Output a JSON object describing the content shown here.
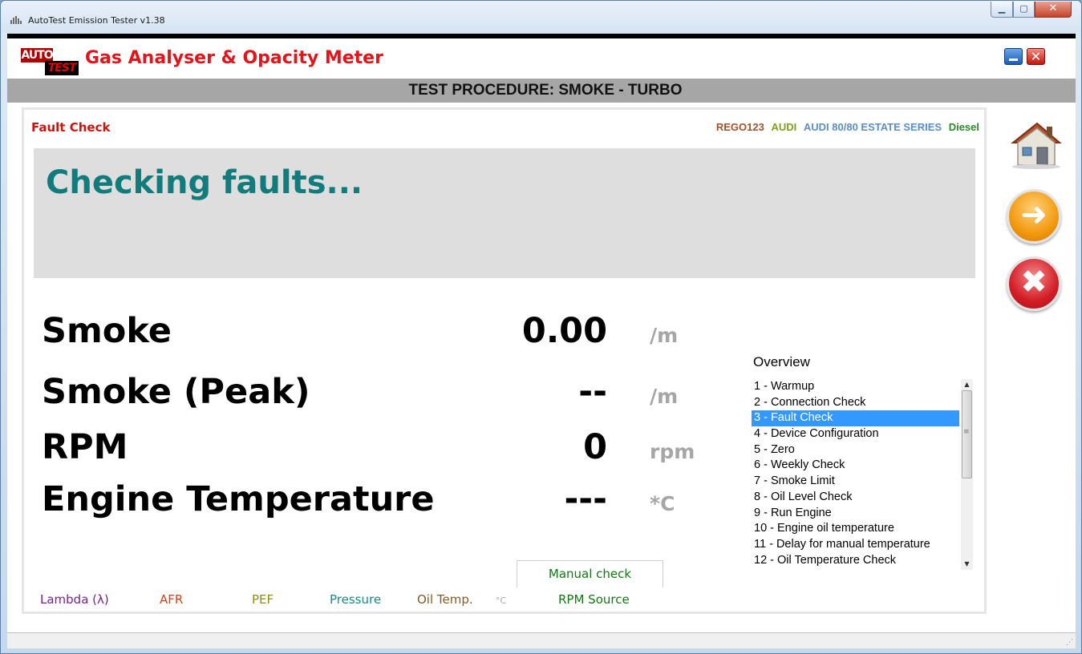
{
  "window": {
    "title": "AutoTest Emission Tester v1.38",
    "min_glyph": "▁",
    "max_glyph": "▢",
    "close_glyph": "✕"
  },
  "app": {
    "logo_top": "AUTO",
    "logo_bottom": "TEST",
    "title": "Gas Analyser & Opacity Meter",
    "close_glyph": "✕"
  },
  "procedure": "TEST PROCEDURE: SMOKE - TURBO",
  "step_title": "Fault Check",
  "vehicle": {
    "rego": "REGO123",
    "make": "AUDI",
    "model": "AUDI 80/80 ESTATE SERIES",
    "fuel": "Diesel"
  },
  "message": "Checking faults...",
  "readings": [
    {
      "label": "Smoke",
      "value": "0.00",
      "unit": "/m"
    },
    {
      "label": "Smoke (Peak)",
      "value": "--",
      "unit": "/m"
    },
    {
      "label": "RPM",
      "value": "0",
      "unit": "rpm"
    },
    {
      "label": "Engine Temperature",
      "value": "---",
      "unit": "*C"
    }
  ],
  "overview": {
    "title": "Overview",
    "selected_index": 2,
    "items": [
      "1 - Warmup",
      "2 - Connection Check",
      "3 - Fault Check",
      "4 - Device Configuration",
      "5 - Zero",
      "6 - Weekly Check",
      "7 - Smoke Limit",
      "8 - Oil Level Check",
      "9 - Run Engine",
      "10 - Engine oil temperature",
      "11 - Delay for manual temperature",
      "12 - Oil Temperature Check"
    ]
  },
  "manual_tab": "Manual check",
  "tabs": {
    "lambda": "Lambda (λ)",
    "afr": "AFR",
    "pef": "PEF",
    "pressure": "Pressure",
    "oil_temp": "Oil Temp.",
    "oil_temp_unit": "°C",
    "rpm_source": "RPM Source"
  },
  "side_buttons": {
    "home_icon": "home-icon",
    "next_glyph": "➜",
    "cancel_glyph": "✖"
  },
  "colors": {
    "title_red": "#e3141a",
    "message_teal": "#127c7c",
    "selection_blue": "#3399ff"
  }
}
